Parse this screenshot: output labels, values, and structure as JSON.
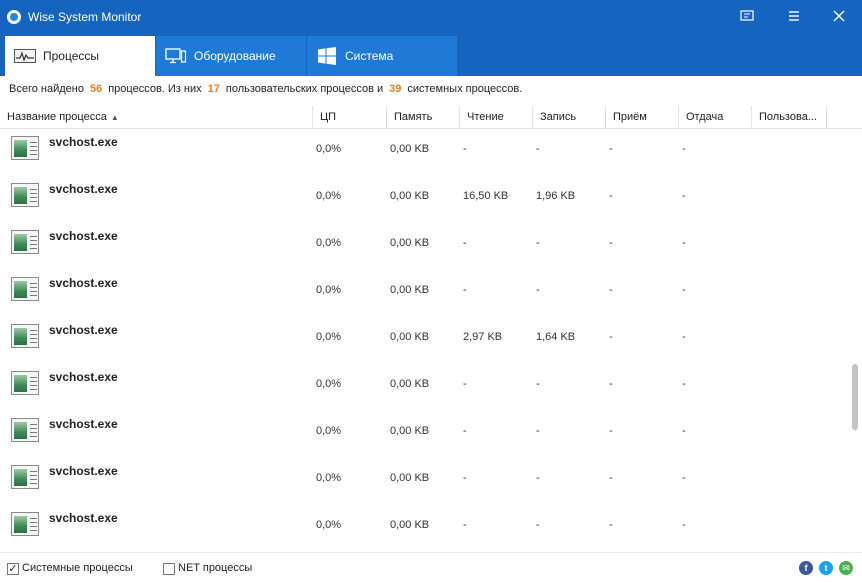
{
  "window": {
    "title": "Wise System Monitor"
  },
  "tabs": [
    {
      "label": "Процессы",
      "active": true
    },
    {
      "label": "Оборудование",
      "active": false
    },
    {
      "label": "Система",
      "active": false
    }
  ],
  "summary": {
    "part1": "Всего найдено",
    "total": "56",
    "part2": "процессов. Из них",
    "user_count": "17",
    "part3": "пользовательских процессов и",
    "system_count": "39",
    "part4": "системных процессов."
  },
  "table": {
    "columns": [
      "Название процесса",
      "ЦП",
      "Память",
      "Чтение",
      "Запись",
      "Приём",
      "Отдача",
      "Пользова..."
    ],
    "sorted_column": "Название процесса",
    "rows": [
      {
        "name": "svchost.exe",
        "cpu": "0,0%",
        "mem": "0,00 KB",
        "read": "-",
        "write": "-",
        "recv": "-",
        "send": "-"
      },
      {
        "name": "svchost.exe",
        "cpu": "0,0%",
        "mem": "0,00 KB",
        "read": "16,50 KB",
        "write": "1,96 KB",
        "recv": "-",
        "send": "-"
      },
      {
        "name": "svchost.exe",
        "cpu": "0,0%",
        "mem": "0,00 KB",
        "read": "-",
        "write": "-",
        "recv": "-",
        "send": "-"
      },
      {
        "name": "svchost.exe",
        "cpu": "0,0%",
        "mem": "0,00 KB",
        "read": "-",
        "write": "-",
        "recv": "-",
        "send": "-"
      },
      {
        "name": "svchost.exe",
        "cpu": "0,0%",
        "mem": "0,00 KB",
        "read": "2,97 KB",
        "write": "1,64 KB",
        "recv": "-",
        "send": "-"
      },
      {
        "name": "svchost.exe",
        "cpu": "0,0%",
        "mem": "0,00 KB",
        "read": "-",
        "write": "-",
        "recv": "-",
        "send": "-"
      },
      {
        "name": "svchost.exe",
        "cpu": "0,0%",
        "mem": "0,00 KB",
        "read": "-",
        "write": "-",
        "recv": "-",
        "send": "-"
      },
      {
        "name": "svchost.exe",
        "cpu": "0,0%",
        "mem": "0,00 KB",
        "read": "-",
        "write": "-",
        "recv": "-",
        "send": "-"
      },
      {
        "name": "svchost.exe",
        "cpu": "0,0%",
        "mem": "0,00 KB",
        "read": "-",
        "write": "-",
        "recv": "-",
        "send": "-"
      }
    ]
  },
  "footer": {
    "system_processes": {
      "label": "Системные процессы",
      "checked": true
    },
    "net_processes": {
      "label": "NET процессы",
      "checked": false
    },
    "social": [
      {
        "icon": "facebook-icon",
        "glyph": "f",
        "color": "#3b5998"
      },
      {
        "icon": "twitter-icon",
        "glyph": "t",
        "color": "#1da1f2"
      },
      {
        "icon": "email-icon",
        "glyph": "✉",
        "color": "#4caf50"
      }
    ]
  },
  "colors": {
    "titlebar": "#1565c0",
    "tab_inactive": "#1e7ad6",
    "accent_numbers": "#e67e22"
  }
}
